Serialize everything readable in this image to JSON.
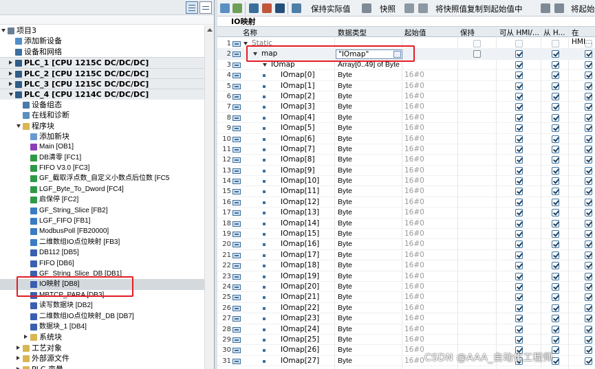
{
  "toolbar": {
    "keep_actual": "保持实际值",
    "snapshot": "快照",
    "copy_snapshot": "将快照值复制到起始值中",
    "copy_start": "将起始"
  },
  "db_title": "IO映射",
  "columns": {
    "name": "名称",
    "datatype": "数据类型",
    "start": "起始值",
    "retain": "保持",
    "hmi_access": "可从 HMI/...",
    "from_h": "从 H...",
    "in_hmi": "在 HMI..."
  },
  "tree": [
    {
      "label": "项目3",
      "indent": 0,
      "expand": "open",
      "icon": "project-icon",
      "bold": false
    },
    {
      "label": "添加新设备",
      "indent": 1,
      "expand": "",
      "icon": "add-device-icon",
      "bold": false
    },
    {
      "label": "设备和网络",
      "indent": 1,
      "expand": "",
      "icon": "network-icon",
      "bold": false
    },
    {
      "label": "PLC_1 [CPU 1215C DC/DC/DC]",
      "indent": 1,
      "expand": "closed",
      "icon": "plc-icon",
      "bold": true,
      "dev": true
    },
    {
      "label": "PLC_2 [CPU 1215C DC/DC/DC]",
      "indent": 1,
      "expand": "closed",
      "icon": "plc-icon",
      "bold": true,
      "dev": true
    },
    {
      "label": "PLC_3 [CPU 1215C DC/DC/DC]",
      "indent": 1,
      "expand": "closed",
      "icon": "plc-icon",
      "bold": true,
      "dev": true
    },
    {
      "label": "PLC_4 [CPU 1214C DC/DC/DC]",
      "indent": 1,
      "expand": "open",
      "icon": "plc-icon",
      "bold": true,
      "dev": true
    },
    {
      "label": "设备组态",
      "indent": 2,
      "expand": "",
      "icon": "device-config-icon",
      "bold": false
    },
    {
      "label": "在线和诊断",
      "indent": 2,
      "expand": "",
      "icon": "diagnostics-icon",
      "bold": false
    },
    {
      "label": "程序块",
      "indent": 2,
      "expand": "open",
      "icon": "folder-icon",
      "bold": false
    },
    {
      "label": "添加新块",
      "indent": 3,
      "expand": "",
      "icon": "add-block-icon",
      "bold": false
    },
    {
      "label": "Main [OB1]",
      "indent": 3,
      "expand": "",
      "icon": "ob-icon",
      "bold": false,
      "small": true
    },
    {
      "label": "DB清零 [FC1]",
      "indent": 3,
      "expand": "",
      "icon": "fc-icon",
      "bold": false,
      "small": true
    },
    {
      "label": "FIFO V3.0 [FC3]",
      "indent": 3,
      "expand": "",
      "icon": "fc-icon",
      "bold": false,
      "small": true
    },
    {
      "label": "GF_截取浮点数_自定义小数点后位数 [FC5",
      "indent": 3,
      "expand": "",
      "icon": "fc-icon",
      "bold": false,
      "small": true
    },
    {
      "label": "LGF_Byte_To_Dword [FC4]",
      "indent": 3,
      "expand": "",
      "icon": "fc-icon",
      "bold": false,
      "small": true
    },
    {
      "label": "启保停 [FC2]",
      "indent": 3,
      "expand": "",
      "icon": "fc-icon",
      "bold": false,
      "small": true
    },
    {
      "label": "GF_String_Slice [FB2]",
      "indent": 3,
      "expand": "",
      "icon": "fb-icon",
      "bold": false,
      "small": true
    },
    {
      "label": "LGF_FIFO [FB1]",
      "indent": 3,
      "expand": "",
      "icon": "fb-icon",
      "bold": false,
      "small": true
    },
    {
      "label": "ModbusPoll [FB20000]",
      "indent": 3,
      "expand": "",
      "icon": "fb-icon",
      "bold": false,
      "small": true
    },
    {
      "label": "二维数组IO点位映射 [FB3]",
      "indent": 3,
      "expand": "",
      "icon": "fb-icon",
      "bold": false,
      "small": true
    },
    {
      "label": "DB112 [DB5]",
      "indent": 3,
      "expand": "",
      "icon": "db-icon",
      "bold": false,
      "small": true
    },
    {
      "label": "FIFO [DB6]",
      "indent": 3,
      "expand": "",
      "icon": "db-icon",
      "bold": false,
      "small": true
    },
    {
      "label": "GF_String_Slice_DB [DB1]",
      "indent": 3,
      "expand": "",
      "icon": "db-icon",
      "bold": false,
      "small": true
    },
    {
      "label": "IO映射 [DB8]",
      "indent": 3,
      "expand": "",
      "icon": "db-icon",
      "bold": false,
      "small": true,
      "selected": true
    },
    {
      "label": "MBTCP_PARA [DB3]",
      "indent": 3,
      "expand": "",
      "icon": "db-icon",
      "bold": false,
      "small": true
    },
    {
      "label": "读写数据块 [DB2]",
      "indent": 3,
      "expand": "",
      "icon": "db-icon",
      "bold": false,
      "small": true
    },
    {
      "label": "二维数组IO点位映射_DB [DB7]",
      "indent": 3,
      "expand": "",
      "icon": "db-icon",
      "bold": false,
      "small": true
    },
    {
      "label": "数据块_1 [DB4]",
      "indent": 3,
      "expand": "",
      "icon": "db-icon",
      "bold": false,
      "small": true
    },
    {
      "label": "系统块",
      "indent": 3,
      "expand": "closed",
      "icon": "folder-icon",
      "bold": false
    },
    {
      "label": "工艺对象",
      "indent": 2,
      "expand": "closed",
      "icon": "folder-icon",
      "bold": false
    },
    {
      "label": "外部源文件",
      "indent": 2,
      "expand": "closed",
      "icon": "folder-icon",
      "bold": false
    },
    {
      "label": "PLC 变量",
      "indent": 2,
      "expand": "closed",
      "icon": "folder-icon",
      "bold": false
    }
  ],
  "rows": [
    {
      "num": "1",
      "name": "Static",
      "level": 0,
      "type": "",
      "start": "",
      "expand": "open",
      "retain": false,
      "c1": false,
      "c2": false,
      "c3": false,
      "gray": true
    },
    {
      "num": "2",
      "name": "map",
      "level": 1,
      "type": "\"IOmap\"",
      "start": "",
      "expand": "open",
      "retain": false,
      "c1": true,
      "c2": true,
      "c3": true,
      "edit": true
    },
    {
      "num": "3",
      "name": "IOmap",
      "level": 2,
      "type": "Array[0..49] of Byte",
      "start": "",
      "expand": "open",
      "retain": false,
      "c1": true,
      "c2": true,
      "c3": true,
      "noretain": true
    },
    {
      "num": "4",
      "name": "IOmap[0]",
      "level": 3,
      "type": "Byte",
      "start": "16#0"
    },
    {
      "num": "5",
      "name": "IOmap[1]",
      "level": 3,
      "type": "Byte",
      "start": "16#0"
    },
    {
      "num": "6",
      "name": "IOmap[2]",
      "level": 3,
      "type": "Byte",
      "start": "16#0"
    },
    {
      "num": "7",
      "name": "IOmap[3]",
      "level": 3,
      "type": "Byte",
      "start": "16#0"
    },
    {
      "num": "8",
      "name": "IOmap[4]",
      "level": 3,
      "type": "Byte",
      "start": "16#0"
    },
    {
      "num": "9",
      "name": "IOmap[5]",
      "level": 3,
      "type": "Byte",
      "start": "16#0"
    },
    {
      "num": "10",
      "name": "IOmap[6]",
      "level": 3,
      "type": "Byte",
      "start": "16#0"
    },
    {
      "num": "11",
      "name": "IOmap[7]",
      "level": 3,
      "type": "Byte",
      "start": "16#0"
    },
    {
      "num": "12",
      "name": "IOmap[8]",
      "level": 3,
      "type": "Byte",
      "start": "16#0"
    },
    {
      "num": "13",
      "name": "IOmap[9]",
      "level": 3,
      "type": "Byte",
      "start": "16#0"
    },
    {
      "num": "14",
      "name": "IOmap[10]",
      "level": 3,
      "type": "Byte",
      "start": "16#0"
    },
    {
      "num": "15",
      "name": "IOmap[11]",
      "level": 3,
      "type": "Byte",
      "start": "16#0"
    },
    {
      "num": "16",
      "name": "IOmap[12]",
      "level": 3,
      "type": "Byte",
      "start": "16#0"
    },
    {
      "num": "17",
      "name": "IOmap[13]",
      "level": 3,
      "type": "Byte",
      "start": "16#0"
    },
    {
      "num": "18",
      "name": "IOmap[14]",
      "level": 3,
      "type": "Byte",
      "start": "16#0"
    },
    {
      "num": "19",
      "name": "IOmap[15]",
      "level": 3,
      "type": "Byte",
      "start": "16#0"
    },
    {
      "num": "20",
      "name": "IOmap[16]",
      "level": 3,
      "type": "Byte",
      "start": "16#0"
    },
    {
      "num": "21",
      "name": "IOmap[17]",
      "level": 3,
      "type": "Byte",
      "start": "16#0"
    },
    {
      "num": "22",
      "name": "IOmap[18]",
      "level": 3,
      "type": "Byte",
      "start": "16#0"
    },
    {
      "num": "23",
      "name": "IOmap[19]",
      "level": 3,
      "type": "Byte",
      "start": "16#0"
    },
    {
      "num": "24",
      "name": "IOmap[20]",
      "level": 3,
      "type": "Byte",
      "start": "16#0"
    },
    {
      "num": "25",
      "name": "IOmap[21]",
      "level": 3,
      "type": "Byte",
      "start": "16#0"
    },
    {
      "num": "26",
      "name": "IOmap[22]",
      "level": 3,
      "type": "Byte",
      "start": "16#0"
    },
    {
      "num": "27",
      "name": "IOmap[23]",
      "level": 3,
      "type": "Byte",
      "start": "16#0"
    },
    {
      "num": "28",
      "name": "IOmap[24]",
      "level": 3,
      "type": "Byte",
      "start": "16#0"
    },
    {
      "num": "29",
      "name": "IOmap[25]",
      "level": 3,
      "type": "Byte",
      "start": "16#0"
    },
    {
      "num": "30",
      "name": "IOmap[26]",
      "level": 3,
      "type": "Byte",
      "start": "16#0"
    },
    {
      "num": "31",
      "name": "IOmap[27]",
      "level": 3,
      "type": "Byte",
      "start": "16#0"
    }
  ],
  "watermark": "CSDN @AAA_自动化工程师",
  "colors": {
    "highlight": "#e21b24",
    "selection": "#d4d9de",
    "header_bg": "#e6ebf0"
  }
}
